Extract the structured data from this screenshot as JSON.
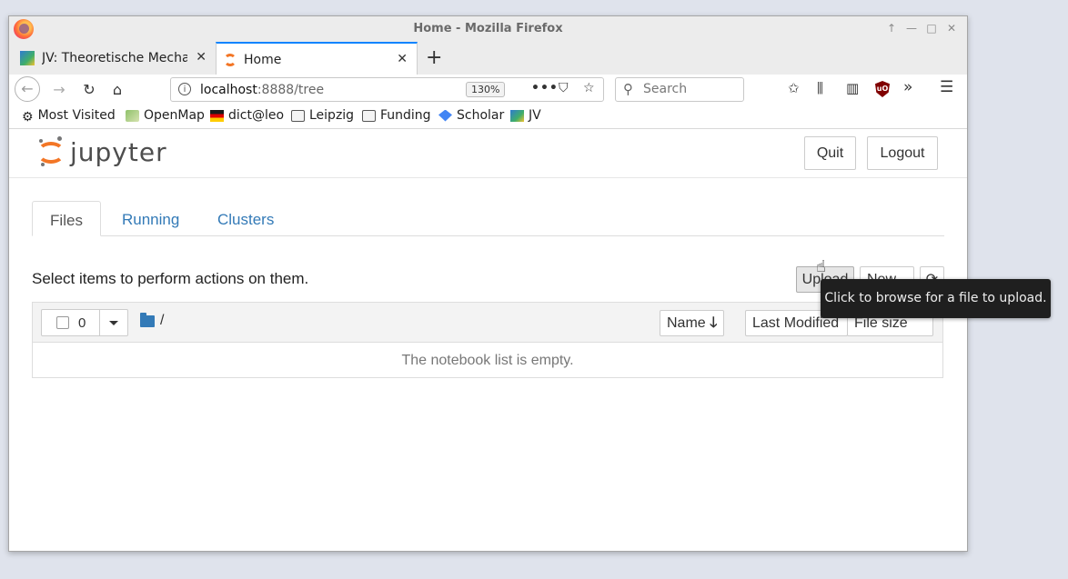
{
  "window": {
    "title": "Home - Mozilla Firefox"
  },
  "tabs": [
    {
      "label": "JV: Theoretische Mechanik",
      "favicon": "image-icon"
    },
    {
      "label": "Home",
      "favicon": "jupyter-icon"
    }
  ],
  "navbar": {
    "url_host": "localhost",
    "url_rest": ":8888/tree",
    "zoom": "130%",
    "search_placeholder": "Search"
  },
  "bookmarks": [
    {
      "label": "Most Visited",
      "icon": "gear-icon"
    },
    {
      "label": "OpenMap",
      "icon": "map-icon"
    },
    {
      "label": "dict@leo",
      "icon": "leo-icon"
    },
    {
      "label": "Leipzig",
      "icon": "folder-icon"
    },
    {
      "label": "Funding",
      "icon": "folder-icon"
    },
    {
      "label": "Scholar",
      "icon": "scholar-icon"
    },
    {
      "label": "JV",
      "icon": "image-icon"
    }
  ],
  "jupyter": {
    "logo_text": "jupyter",
    "quit_label": "Quit",
    "logout_label": "Logout",
    "tabs": [
      "Files",
      "Running",
      "Clusters"
    ],
    "hint": "Select items to perform actions on them.",
    "upload_label": "Upload",
    "new_label": "New",
    "selected_count": "0",
    "breadcrumb": "/",
    "sort": {
      "name": "Name",
      "last_modified": "Last Modified",
      "file_size": "File size"
    },
    "empty_message": "The notebook list is empty.",
    "tooltip": "Click to browse for a file to upload."
  },
  "colors": {
    "accent": "#337ab7",
    "jupyter_orange": "#f37626",
    "firefox_tab_accent": "#0a84ff"
  }
}
